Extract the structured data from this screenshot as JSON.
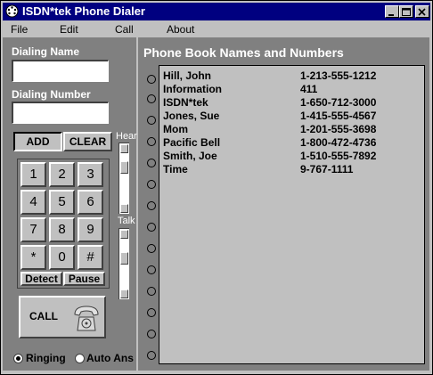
{
  "window": {
    "title": "ISDN*tek Phone Dialer"
  },
  "menu": {
    "file": "File",
    "edit": "Edit",
    "call": "Call",
    "about": "About"
  },
  "dialer": {
    "name_label": "Dialing Name",
    "name_value": "",
    "number_label": "Dialing Number",
    "number_value": "",
    "add_label": "ADD",
    "clear_label": "CLEAR",
    "keys": [
      "1",
      "2",
      "3",
      "4",
      "5",
      "6",
      "7",
      "8",
      "9",
      "*",
      "0",
      "#"
    ],
    "detect_label": "Detect",
    "pause_label": "Pause",
    "call_label": "CALL"
  },
  "volume": {
    "hear_label": "Hear",
    "talk_label": "Talk"
  },
  "ring_mode": {
    "ringing_label": "Ringing",
    "auto_answer_label": "Auto Ans",
    "selected": "Ringing"
  },
  "phonebook": {
    "title": "Phone Book Names and Numbers",
    "entries": [
      {
        "name": "Hill, John",
        "number": "1-213-555-1212"
      },
      {
        "name": "Information",
        "number": "411"
      },
      {
        "name": "ISDN*tek",
        "number": "1-650-712-3000"
      },
      {
        "name": "Jones, Sue",
        "number": "1-415-555-4567"
      },
      {
        "name": "Mom",
        "number": "1-201-555-3698"
      },
      {
        "name": "Pacific Bell",
        "number": "1-800-472-4736"
      },
      {
        "name": "Smith, Joe",
        "number": "1-510-555-7892"
      },
      {
        "name": "Time",
        "number": "9-767-1111"
      }
    ]
  },
  "colors": {
    "titlebar": "#000080",
    "panel": "#808080",
    "face": "#c0c0c0"
  },
  "icons": {
    "app": "phone-dial-icon",
    "call": "telephone-icon"
  }
}
